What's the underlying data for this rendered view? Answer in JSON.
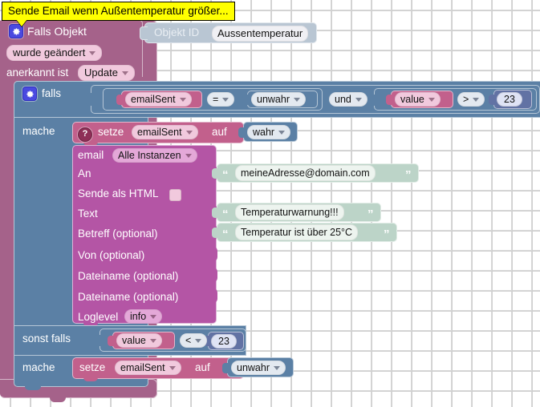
{
  "tooltip": {
    "text": "Sende Email wenn Außentemperatur größer..."
  },
  "program": {
    "trigger": {
      "icon": "gear-icon",
      "title": "Falls Objekt",
      "object_id_label": "Objekt ID",
      "object_id_value": "Aussentemperatur",
      "condition_dropdown": "wurde geändert",
      "ack_label": "anerkannt ist",
      "ack_dropdown": "Update"
    },
    "if_block": {
      "icon": "gear-icon",
      "if_label": "falls",
      "do_label": "mache",
      "else_if_label": "sonst falls",
      "else_do_label": "mache",
      "condition": {
        "left_var": "emailSent",
        "left_op": "=",
        "left_value": "unwahr",
        "logic_op": "und",
        "right_var": "value",
        "right_op": ">",
        "right_value": "23"
      },
      "else_condition": {
        "var": "value",
        "op": "<",
        "value": "23"
      }
    },
    "set_true": {
      "icon": "question-icon",
      "verb": "setze",
      "variable": "emailSent",
      "auf": "auf",
      "value": "wahr"
    },
    "set_false": {
      "verb": "setze",
      "variable": "emailSent",
      "auf": "auf",
      "value": "unwahr"
    },
    "email": {
      "title": "email",
      "instance": "Alle Instanzen",
      "rows": [
        {
          "label": "An",
          "value": "meineAdresse@domain.com",
          "kind": "text"
        },
        {
          "label": "Sende als HTML",
          "value": "",
          "kind": "checkbox"
        },
        {
          "label": "Text",
          "value": "Temperaturwarnung!!!",
          "kind": "text"
        },
        {
          "label": "Betreff (optional)",
          "value": "Temperatur ist über 25°C",
          "kind": "text"
        },
        {
          "label": "Von (optional)",
          "value": "",
          "kind": "empty"
        },
        {
          "label": "Dateiname (optional)",
          "value": "",
          "kind": "empty"
        },
        {
          "label": "Dateiname (optional)",
          "value": "",
          "kind": "empty"
        }
      ],
      "loglevel_label": "Loglevel",
      "loglevel_value": "info"
    }
  },
  "colors": {
    "control": "#a5628a",
    "logic": "#5b80a5",
    "variable": "#c2608c",
    "sendto": "#b455a5",
    "text": "#bcd4c8",
    "math": "#6272a4",
    "tooltip_bg": "#ffff00",
    "canvas_bg": "#ffffff"
  }
}
